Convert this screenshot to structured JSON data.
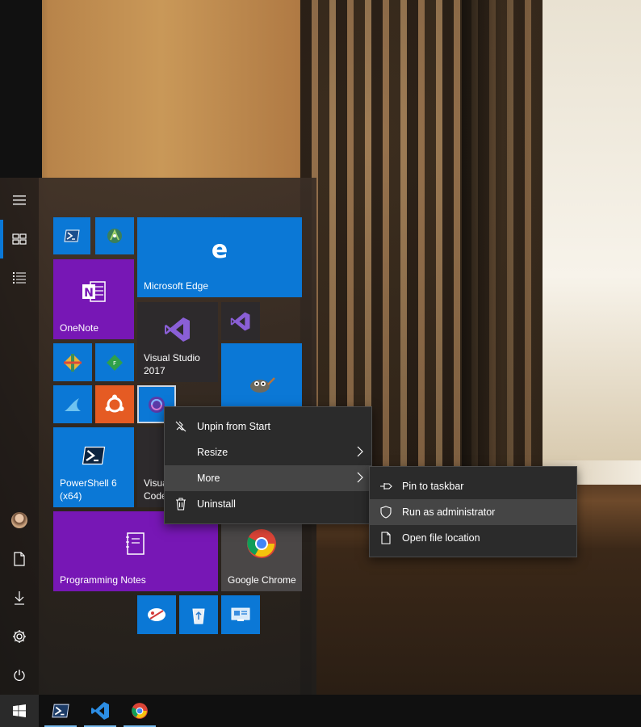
{
  "start_menu": {
    "rail": {
      "menu_icon": "hamburger-icon",
      "tiles_icon": "tiles-view-icon",
      "list_icon": "all-apps-list-icon",
      "user_icon": "user-avatar",
      "documents_icon": "document-icon",
      "downloads_icon": "download-icon",
      "settings_icon": "gear-icon",
      "power_icon": "power-icon"
    },
    "tiles": {
      "onenote": "OneNote",
      "edge": "Microsoft Edge",
      "visual_studio": "Visual Studio\n2017",
      "powershell6": "PowerShell 6\n(x64)",
      "vscode_partial": "Visua\nCode",
      "programming_notes": "Programming Notes",
      "chrome": "Google Chrome"
    }
  },
  "context_menu": {
    "items": [
      {
        "label": "Unpin from Start",
        "icon": "unpin-icon"
      },
      {
        "label": "Resize",
        "icon": ""
      },
      {
        "label": "More",
        "icon": ""
      },
      {
        "label": "Uninstall",
        "icon": "trash-icon"
      }
    ]
  },
  "submenu": {
    "items": [
      {
        "label": "Pin to taskbar",
        "icon": "pin-icon"
      },
      {
        "label": "Run as administrator",
        "icon": "shield-icon"
      },
      {
        "label": "Open file location",
        "icon": "file-icon"
      }
    ]
  },
  "taskbar": {
    "start": "windows-logo-icon",
    "apps": [
      "powershell-icon",
      "vscode-icon",
      "chrome-icon"
    ]
  },
  "colors": {
    "tile_blue": "#0b78d6",
    "tile_purple": "#7717b5",
    "accent": "#0a78d7",
    "menu_bg": "#2b2b2b"
  }
}
